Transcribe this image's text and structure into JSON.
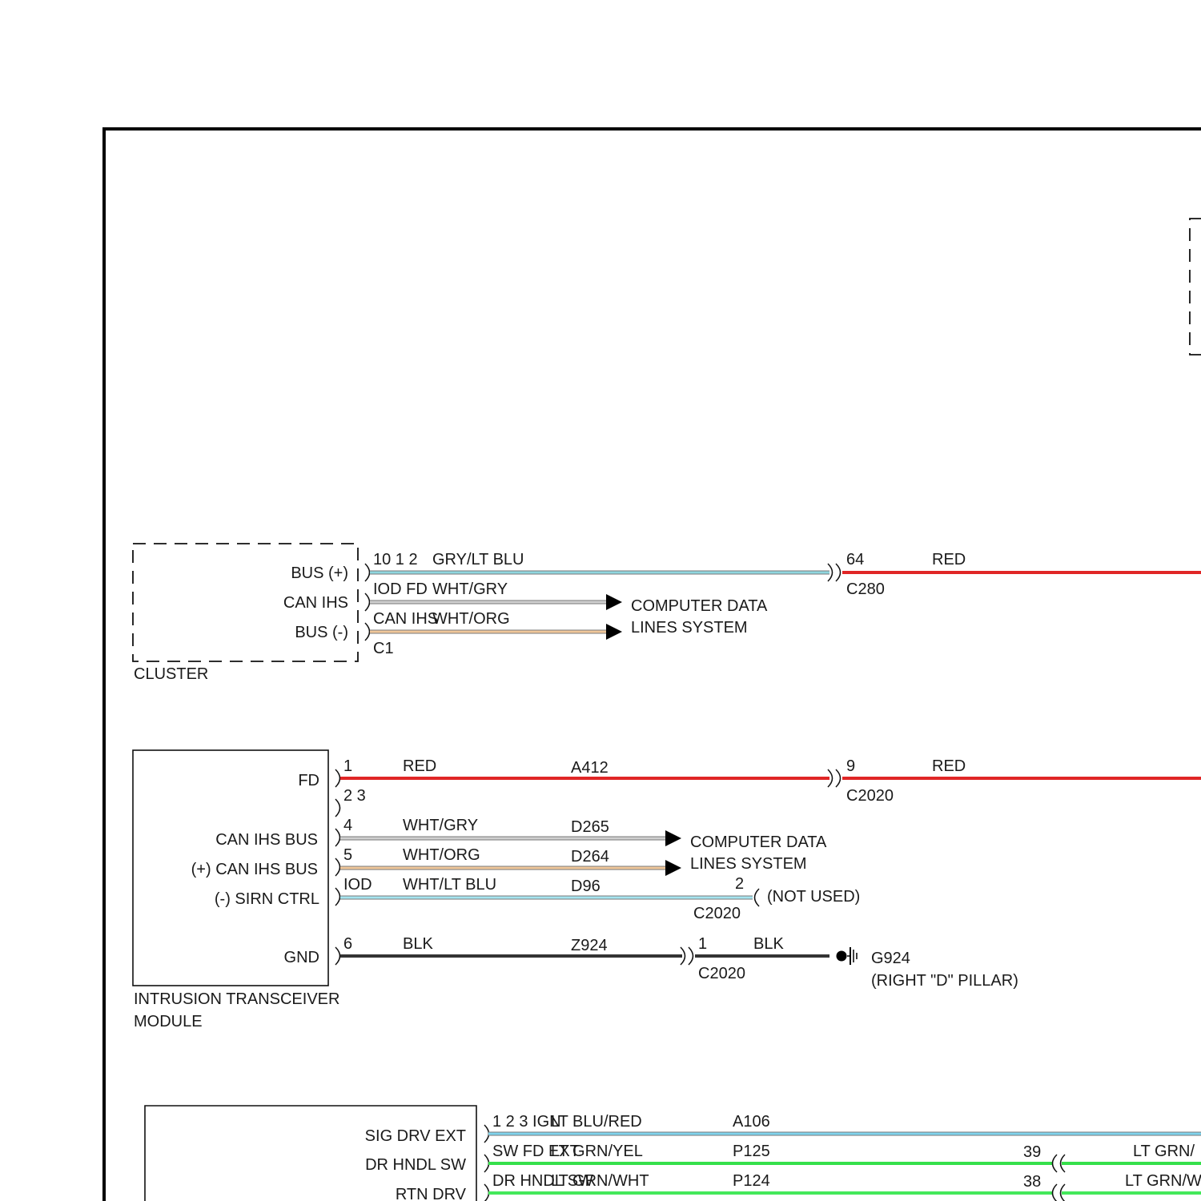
{
  "cluster": {
    "name": "CLUSTER",
    "pin_labels": [
      "BUS (+)",
      "CAN IHS",
      "BUS (-)"
    ],
    "connector": "C1",
    "wires": [
      {
        "pins": "10 1 2",
        "color_name": "GRY/LT BLU",
        "circuit": "",
        "color": "#8fd6df"
      },
      {
        "pins": "IOD FD",
        "color_name": "WHT/GRY",
        "circuit": "",
        "color": "#cfcfcf"
      },
      {
        "pins": "CAN IHS",
        "color_name": "WHT/ORG",
        "circuit": "",
        "color": "#f0c79a"
      }
    ],
    "destination": [
      "COMPUTER DATA",
      "LINES SYSTEM"
    ],
    "inline": {
      "pin": "64",
      "connector": "C280",
      "color_name": "RED",
      "color": "#e02626"
    }
  },
  "itm": {
    "name": [
      "INTRUSION TRANSCEIVER",
      "MODULE"
    ],
    "pin_labels": [
      "FD",
      "CAN IHS BUS",
      "(+) CAN IHS BUS",
      "(-) SIRN CTRL",
      "GND"
    ],
    "wires": [
      {
        "pin": "1",
        "color_name": "RED",
        "circuit": "A412",
        "color": "#e02626"
      },
      {
        "pin": "2 3",
        "color_name": "",
        "circuit": "",
        "color": ""
      },
      {
        "pin": "4",
        "color_name": "WHT/GRY",
        "circuit": "D265",
        "color": "#cfcfcf"
      },
      {
        "pin": "5",
        "color_name": "WHT/ORG",
        "circuit": "D264",
        "color": "#f0c79a"
      },
      {
        "pin": "IOD",
        "color_name": "WHT/LT BLU",
        "circuit": "D96",
        "color": "#a5e4ef"
      },
      {
        "pin": "6",
        "color_name": "BLK",
        "circuit": "Z924",
        "color": "#333333"
      }
    ],
    "destination": [
      "COMPUTER DATA",
      "LINES SYSTEM"
    ],
    "red_inline": {
      "pin": "9",
      "connector": "C2020",
      "color_name": "RED"
    },
    "not_used": {
      "pin": "2",
      "connector": "C2020",
      "text": "(NOT USED)"
    },
    "gnd_inline": {
      "pin": "1",
      "connector": "C2020",
      "color_name": "BLK"
    },
    "ground": {
      "id": "G924",
      "location": "(RIGHT \"D\" PILLAR)"
    }
  },
  "lower_module": {
    "pin_labels": [
      "SIG DRV EXT",
      "DR HNDL SW",
      "RTN DRV"
    ],
    "wires": [
      {
        "pins": "1 2 3 IGN",
        "color_name": "LT BLU/RED",
        "circuit": "A106",
        "color": "#7fd3ec",
        "inline_pin": "",
        "right_text": ""
      },
      {
        "pins": "SW FD EXT",
        "color_name": "LT GRN/YEL",
        "circuit": "P125",
        "color": "#35e04a",
        "inline_pin": "39",
        "right_text": "LT GRN/"
      },
      {
        "pins": "DR HNDL SW",
        "color_name": "LT GRN/WHT",
        "circuit": "P124",
        "color": "#44e85a",
        "inline_pin": "38",
        "right_text": "LT GRN/W"
      }
    ]
  }
}
